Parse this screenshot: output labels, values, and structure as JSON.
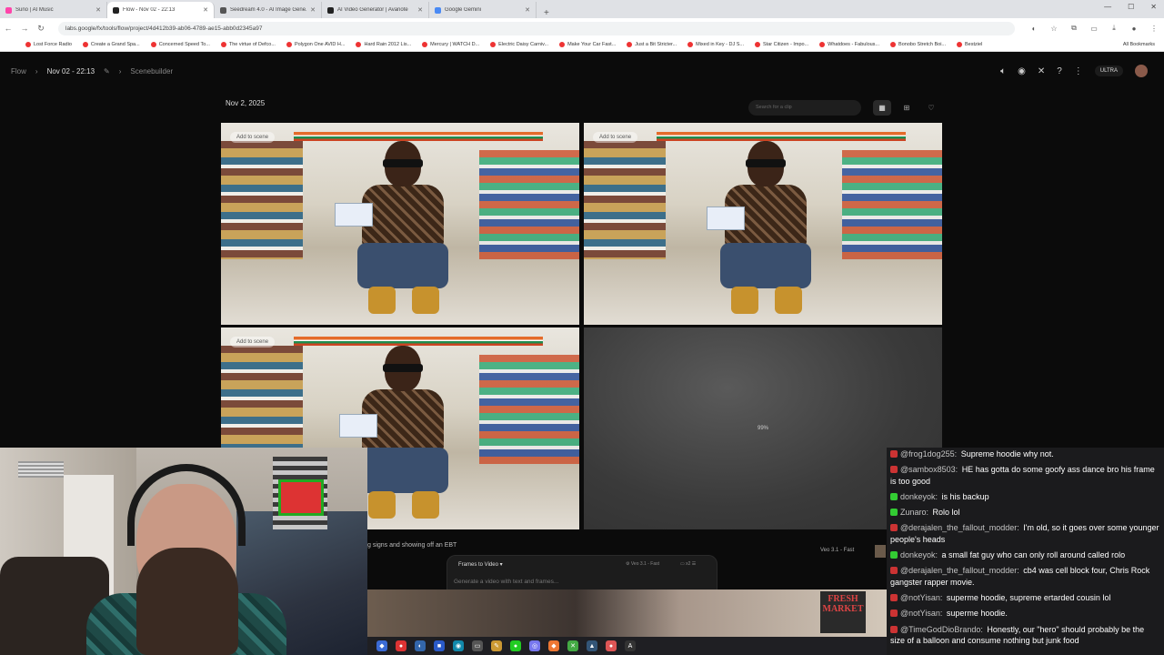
{
  "browser": {
    "tabs": [
      {
        "title": "Suno | AI Music",
        "color": "#f4a"
      },
      {
        "title": "Flow - Nov 02 - 22:13",
        "color": "#222"
      },
      {
        "title": "Seedream 4.0 - AI Image Gene...",
        "color": "#555"
      },
      {
        "title": "AI Video Generator | Avanote",
        "color": "#222"
      },
      {
        "title": "Google Gemini",
        "color": "#4a8af4"
      }
    ],
    "url": "labs.google/fx/tools/flow/project/4d412b39-ab06-4789-ae15-abb0d2345a97",
    "bookmarks": [
      "Lost Force Radio",
      "Create a Grand Spa...",
      "Concerned Speed To...",
      "The virtue of Defco...",
      "Polygon One AVID H...",
      "Hard Rain 2012 Lis...",
      "Mercury | WATCH D...",
      "Electric Daisy Carniv...",
      "Make Your Car Fast...",
      "Just a Bit Stricter...",
      "Mixed in Key - DJ S...",
      "Star Citizen - Impo...",
      "Whatdoes - Fabulous...",
      "Bonobo Stretch Boi...",
      "Bestziel"
    ],
    "all_bookmarks": "All Bookmarks"
  },
  "app": {
    "breadcrumb_root": "Flow",
    "project_title": "Nov 02 - 22:13",
    "section": "Scenebuilder",
    "badge": "ULTRA",
    "date": "Nov 2, 2025",
    "search_placeholder": "Search for a clip",
    "add_to_scene": "Add to scene",
    "progress": "99%",
    "prompt_text": "g signs and showing off an EBT",
    "clip_model": "Veo 3.1 - Fast",
    "composer": {
      "mode": "Frames to Video",
      "model": "Veo 3.1 - Fast",
      "count": "x2",
      "placeholder": "Generate a video with text and frames..."
    },
    "fresh_sign": "FRESH MARKET"
  },
  "chat": [
    {
      "user": "@frog1dog255:",
      "text": "Supreme hoodie why not.",
      "badge": "#c33"
    },
    {
      "user": "@sambox8503:",
      "text": "HE has gotta do some goofy ass dance bro his frame is too good",
      "badge": "#c33"
    },
    {
      "user": "donkeyok:",
      "text": "is his backup",
      "badge": "#3c3"
    },
    {
      "user": "Zunaro:",
      "text": "Rolo lol",
      "badge": "#3c3"
    },
    {
      "user": "@derajalen_the_fallout_modder:",
      "text": "I'm old, so it goes over some younger people's heads",
      "badge": "#c33"
    },
    {
      "user": "donkeyok:",
      "text": "a small fat guy who can only roll around called rolo",
      "badge": "#3c3"
    },
    {
      "user": "@derajalen_the_fallout_modder:",
      "text": "cb4 was cell block four, Chris Rock gangster rapper movie.",
      "badge": "#c33"
    },
    {
      "user": "@notYisan:",
      "text": "superme hoodie, supreme ertarded cousin lol",
      "badge": "#c33"
    },
    {
      "user": "@notYisan:",
      "text": "superme hoodie.",
      "badge": "#c33"
    },
    {
      "user": "@TimeGodDioBrando:",
      "text": "Honestly, our \"hero\" should probably be the size of a balloon and consume nothing but junk food",
      "badge": "#c33"
    }
  ]
}
